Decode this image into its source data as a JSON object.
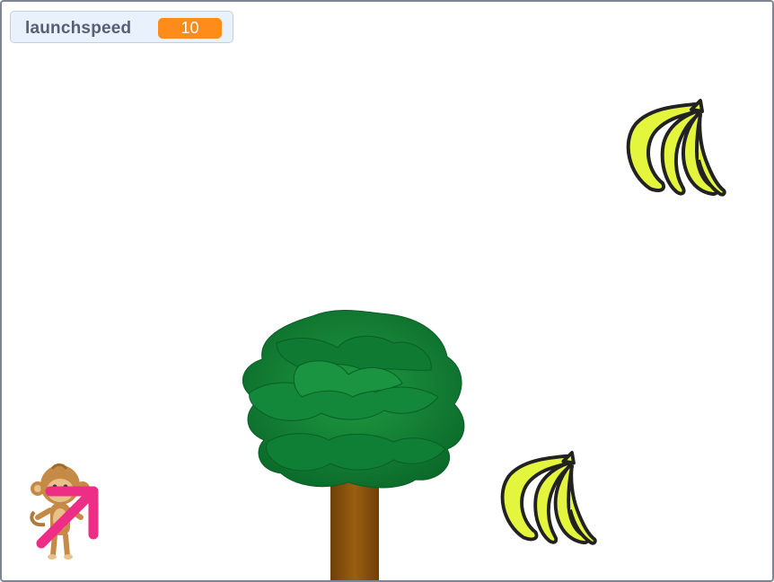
{
  "monitor": {
    "label": "launchspeed",
    "value": "10"
  },
  "sprites": {
    "monkey": "monkey-sprite",
    "arrow": "arrow-sprite",
    "tree": "tree-sprite",
    "banana_top": "banana-sprite",
    "banana_bottom": "banana-sprite"
  },
  "colors": {
    "monitor_bg": "#e9f1fc",
    "monitor_value_bg": "#ff8c1a",
    "monitor_label": "#575e75",
    "foliage_dark": "#0a6b2a",
    "foliage_light": "#1d9a3e",
    "trunk": "#8a5410",
    "banana": "#e4f53d",
    "arrow": "#ee2d86"
  }
}
